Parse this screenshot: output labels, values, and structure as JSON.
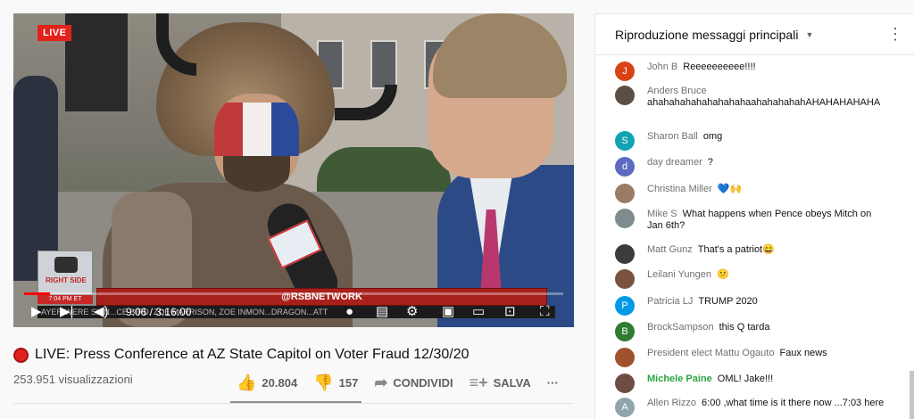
{
  "player": {
    "live_badge": "LIVE",
    "logo_line1": "RIGHT SIDE",
    "logo_time": "7:04 PM ET",
    "banner": "@RSBNETWORK",
    "ticker": "AYER WERE SKIN...CE BIRD, ZOE HARRISON, ZOE INMON...DRAGON...ATT",
    "time_readout": "9:06 / 3:16:00",
    "progress_fraction": 0.048
  },
  "video": {
    "title": "LIVE: Press Conference at AZ State Capitol on Voter Fraud 12/30/20",
    "views": "253.951 visualizzazioni",
    "likes": "20.804",
    "dislikes": "157",
    "share_label": "CONDIVIDI",
    "save_label": "SALVA",
    "more": "···"
  },
  "chat": {
    "header": "Riproduzione messaggi principali",
    "messages": [
      {
        "author": "John B",
        "text": "Reeeeeeeeee!!!!",
        "initial": "J",
        "color": "#d84315"
      },
      {
        "author": "Anders Bruce",
        "text": "ahahahahahahahahahaahahahahahAHAHAHAHAHA",
        "initial": "",
        "color": "#5d4e44"
      },
      {
        "author": "Sharon Ball",
        "text": "omg",
        "initial": "S",
        "color": "#12a3b4"
      },
      {
        "author": "day dreamer",
        "text": "?",
        "initial": "d",
        "color": "#5c6bc0"
      },
      {
        "author": "Christina Miller",
        "text": "💙🙌",
        "initial": "",
        "color": "#9b7b67"
      },
      {
        "author": "Mike S",
        "text": "What happens when Pence obeys Mitch on Jan 6th?",
        "initial": "",
        "color": "#7f8c8d"
      },
      {
        "author": "Matt Gunz",
        "text": "That's a patriot😄",
        "initial": "",
        "color": "#3c3c3c"
      },
      {
        "author": "Leilani Yungen",
        "text": "😕",
        "initial": "",
        "color": "#7a5240"
      },
      {
        "author": "Patricia LJ",
        "text": "TRUMP 2020",
        "initial": "P",
        "color": "#039be5"
      },
      {
        "author": "BrockSampson",
        "text": "this Q tarda",
        "initial": "B",
        "color": "#2e7d32"
      },
      {
        "author": "President elect Mattu Ogauto",
        "text": "Faux news",
        "initial": "",
        "color": "#a0522d"
      },
      {
        "author": "Michele Paine",
        "text": "OML! Jake!!!",
        "initial": "",
        "color": "#6d4c41"
      },
      {
        "author": "Allen Rizzo",
        "text": "6:00 ,what time is it there now ...7:03 here",
        "initial": "A",
        "color": "#90a4ae"
      }
    ]
  }
}
